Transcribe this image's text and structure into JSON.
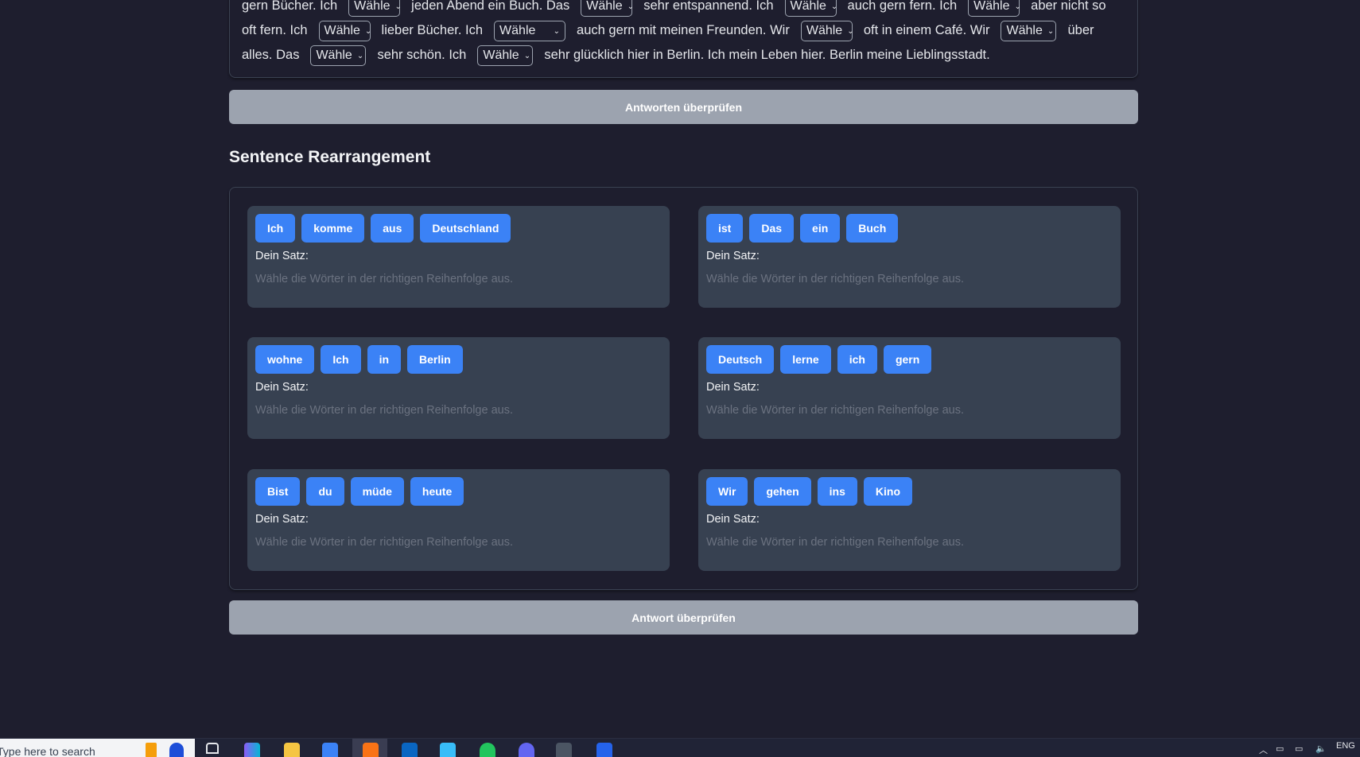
{
  "cloze": {
    "select_label": "Wähle",
    "line1": [
      "gern Bücher. Ich",
      "jeden Abend ein Buch. Das",
      "sehr entspannend. Ich",
      "auch gern fern. Ich",
      "aber nicht so"
    ],
    "line2": [
      "oft fern. Ich",
      "lieber Bücher. Ich",
      "auch gern mit meinen Freunden. Wir",
      "oft in einem Café. Wir",
      "über"
    ],
    "line3": [
      "alles. Das",
      "sehr schön. Ich",
      "sehr glücklich hier in Berlin. Ich mein Leben hier. Berlin meine Lieblingsstadt."
    ],
    "check_button": "Antworten überprüfen"
  },
  "rearrangement": {
    "title": "Sentence Rearrangement",
    "sentence_label": "Dein Satz:",
    "hint": "Wähle die Wörter in der richtigen Reihenfolge aus.",
    "puzzles": [
      {
        "words": [
          "Ich",
          "komme",
          "aus",
          "Deutschland"
        ]
      },
      {
        "words": [
          "ist",
          "Das",
          "ein",
          "Buch"
        ]
      },
      {
        "words": [
          "wohne",
          "Ich",
          "in",
          "Berlin"
        ]
      },
      {
        "words": [
          "Deutsch",
          "lerne",
          "ich",
          "gern"
        ]
      },
      {
        "words": [
          "Bist",
          "du",
          "müde",
          "heute"
        ]
      },
      {
        "words": [
          "Wir",
          "gehen",
          "ins",
          "Kino"
        ]
      }
    ],
    "check_button": "Antwort überprüfen"
  },
  "taskbar": {
    "search_placeholder": "Type here to search",
    "language": "ENG",
    "icons": [
      "copilot-icon",
      "file-explorer-icon",
      "store-icon",
      "brave-browser-icon",
      "outlook-icon",
      "app-icon",
      "spotify-icon",
      "discord-icon",
      "terminal-icon",
      "vscode-icon"
    ]
  },
  "colors": {
    "background": "#1e1e2e",
    "word_chip": "#3b82f6",
    "card": "#374151",
    "button": "#9ca3af"
  }
}
